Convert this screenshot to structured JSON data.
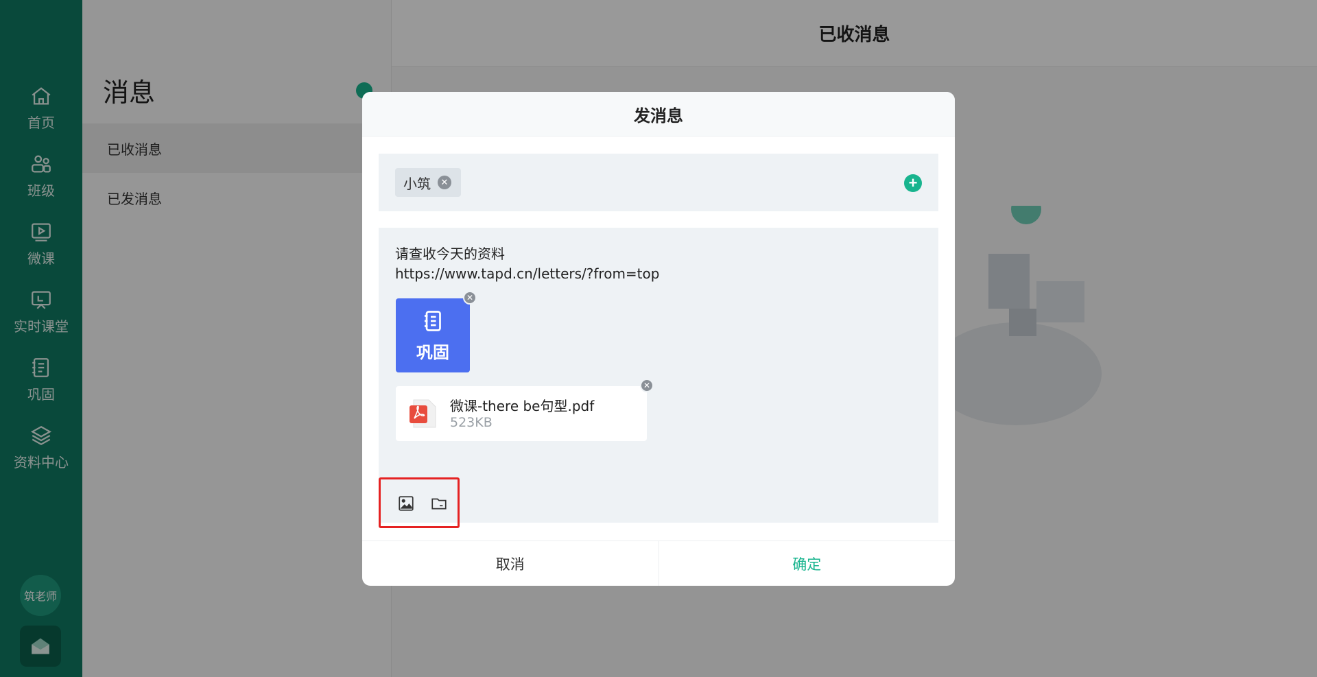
{
  "nav": {
    "items": [
      {
        "label": "首页",
        "icon": "home-icon"
      },
      {
        "label": "班级",
        "icon": "class-icon"
      },
      {
        "label": "微课",
        "icon": "micro-lesson-icon"
      },
      {
        "label": "实时课堂",
        "icon": "live-class-icon"
      },
      {
        "label": "巩固",
        "icon": "notebook-icon"
      },
      {
        "label": "资料中心",
        "icon": "layers-icon"
      }
    ],
    "avatar_label": "筑老师",
    "mail_icon": "mail-icon"
  },
  "panel": {
    "title": "消息",
    "items": [
      {
        "label": "已收消息",
        "active": true
      },
      {
        "label": "已发消息",
        "active": false
      }
    ]
  },
  "main": {
    "header_title": "已收消息"
  },
  "dialog": {
    "title": "发消息",
    "recipient": "小筑",
    "message_lines": [
      "请查收今天的资料",
      "https://www.tapd.cn/letters/?from=top"
    ],
    "review_card_label": "巩固",
    "file": {
      "name": "微课-there be句型.pdf",
      "size": "523KB"
    },
    "cancel_label": "取消",
    "confirm_label": "确定"
  },
  "colors": {
    "rail": "#0f7a63",
    "accent": "#18b48e",
    "review_card": "#4c6ff0",
    "highlight_box": "#e52222",
    "pdf_red": "#e84c3d"
  }
}
